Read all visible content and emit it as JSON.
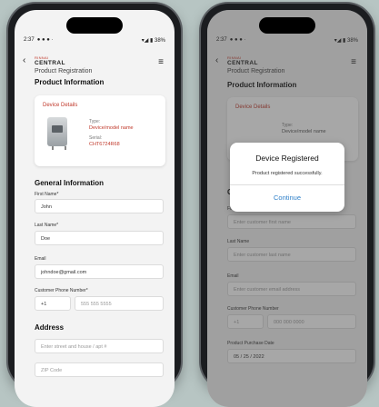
{
  "left": {
    "status": {
      "time": "2:37",
      "battery": "38%"
    },
    "header": {
      "back": "‹",
      "logo_top": "RINNAI",
      "logo_main": "CENTRAL",
      "title": "Product Registration",
      "menu": "≡"
    },
    "product_information": "Product Information",
    "device_details": {
      "title": "Device Details",
      "type_label": "Type:",
      "type_value": "Device/model name",
      "serial_label": "Serial:",
      "serial_value": "CHT6724R68"
    },
    "general_information": "General Information",
    "first_name": {
      "label": "First Name*",
      "value": "John"
    },
    "last_name": {
      "label": "Last Name*",
      "value": "Doe"
    },
    "email": {
      "label": "Email",
      "value": "johndoe@gmail.com"
    },
    "phone": {
      "label": "Customer Phone Number*",
      "code": "+1",
      "placeholder": "555 555 5555"
    },
    "address": "Address",
    "street": {
      "placeholder": "Enter street and house / apt #"
    },
    "zip": {
      "placeholder": "ZIP Code"
    }
  },
  "right": {
    "status": {
      "time": "2:37",
      "battery": "38%"
    },
    "header": {
      "back": "‹",
      "logo_top": "RINNAI",
      "logo_main": "CENTRAL",
      "title": "Product Registration",
      "menu": "≡"
    },
    "product_information": "Product Information",
    "device_details": {
      "title": "Device Details",
      "type_label": "Type:",
      "type_value": "Device/model name"
    },
    "general_information_clipped": "Ge",
    "first_name": {
      "label": "Firs",
      "placeholder": "Enter customer first name"
    },
    "last_name": {
      "label": "Last Name",
      "placeholder": "Enter customer last name"
    },
    "email": {
      "label": "Email",
      "placeholder": "Enter customer email address"
    },
    "phone": {
      "label": "Customer Phone Number",
      "code": "+1",
      "placeholder": "000 000 0000"
    },
    "purchase_date": {
      "label": "Product Purchase Date",
      "value": "05 / 25 / 2022"
    },
    "dialog": {
      "title": "Device Registered",
      "message": "Product registered successfully.",
      "button": "Continue"
    }
  }
}
